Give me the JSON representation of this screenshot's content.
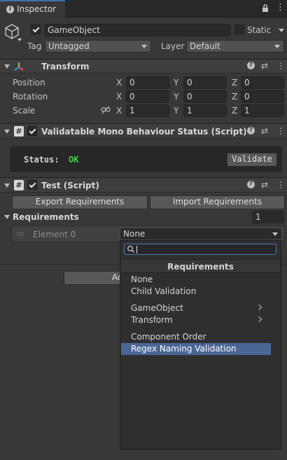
{
  "tab": {
    "title": "Inspector"
  },
  "object": {
    "name": "GameObject",
    "static_label": "Static",
    "tag_label": "Tag",
    "tag_value": "Untagged",
    "layer_label": "Layer",
    "layer_value": "Default"
  },
  "transform": {
    "title": "Transform",
    "rows": [
      {
        "label": "Position",
        "x": "0",
        "y": "0",
        "z": "0"
      },
      {
        "label": "Rotation",
        "x": "0",
        "y": "0",
        "z": "0"
      },
      {
        "label": "Scale",
        "x": "1",
        "y": "1",
        "z": "1"
      }
    ],
    "axes": {
      "x": "X",
      "y": "Y",
      "z": "Z"
    }
  },
  "status_component": {
    "title": "Validatable Mono Behaviour Status (Script)",
    "status_label": "Status:",
    "status_value": "OK",
    "status_color": "#3fd13f",
    "validate_button": "Validate"
  },
  "test_component": {
    "title": "Test (Script)",
    "export_button": "Export Requirements",
    "import_button": "Import Requirements",
    "requirements_label": "Requirements",
    "requirements_count": "1",
    "element_label": "Element 0",
    "element_value": "None",
    "add_button_partial": "Ac"
  },
  "popup": {
    "search_value": "",
    "header": "Requirements",
    "items": [
      {
        "label": "None"
      },
      {
        "label": "Child Validation"
      },
      {
        "label": "GameObject"
      },
      {
        "label": "Transform"
      },
      {
        "label": "Component Order"
      },
      {
        "label": "Regex Naming Validation"
      }
    ]
  },
  "colors": {
    "accent_selection": "#4b6695",
    "status_ok": "#3fd13f"
  }
}
